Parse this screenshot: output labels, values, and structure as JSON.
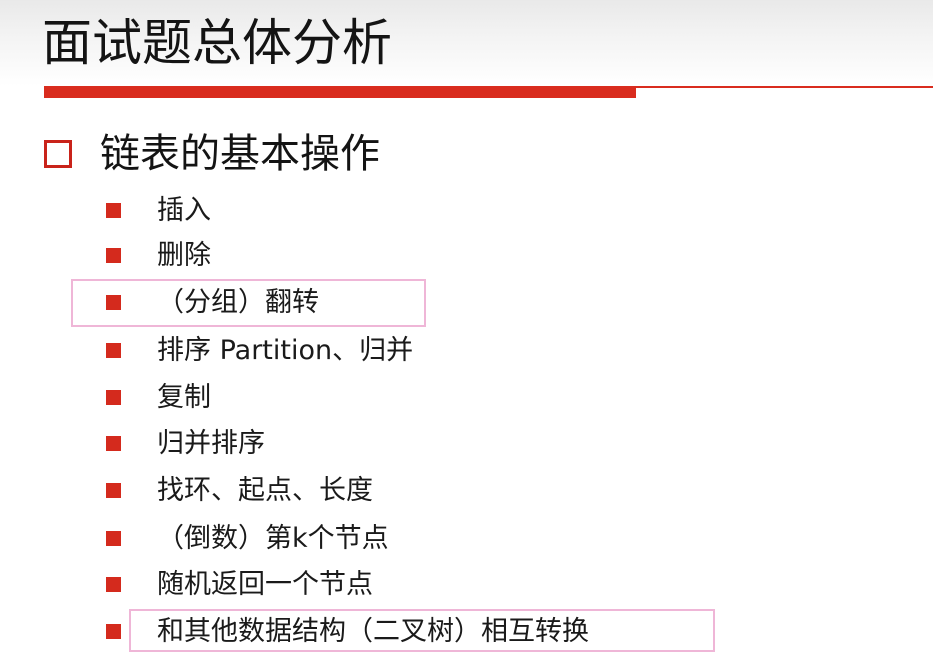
{
  "slide": {
    "title": "面试题总体分析",
    "section": {
      "heading": "链表的基本操作",
      "items": [
        {
          "label": "插入"
        },
        {
          "label": "删除"
        },
        {
          "label": "（分组）翻转"
        },
        {
          "label": "排序 Partition、归并"
        },
        {
          "label": "复制"
        },
        {
          "label": "归并排序"
        },
        {
          "label": "找环、起点、长度"
        },
        {
          "label": "（倒数）第k个节点"
        },
        {
          "label": "随机返回一个节点"
        },
        {
          "label": "和其他数据结构（二叉树）相互转换"
        }
      ]
    }
  },
  "colors": {
    "accent_red": "#d92c1e",
    "highlight_pink": "#efb6d7"
  }
}
